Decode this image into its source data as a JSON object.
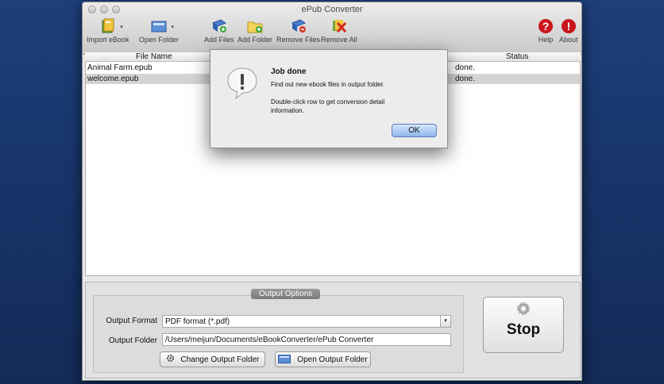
{
  "window": {
    "title": "ePub Converter"
  },
  "toolbar": {
    "import_ebook": "Import eBook",
    "open_folder": "Open Folder",
    "add_files": "Add Files",
    "add_folder": "Add Folder",
    "remove_files": "Remove Files",
    "remove_all": "Remove All",
    "help": "Help",
    "about": "About",
    "dropdown_glyph": "▾"
  },
  "file_list": {
    "columns": [
      "File Name",
      "Status"
    ],
    "rows": [
      {
        "name": "Animal Farm.epub",
        "status": "done."
      },
      {
        "name": "welcome.epub",
        "status": "done."
      }
    ]
  },
  "output_options": {
    "title": "Output Options",
    "format_label": "Output Format",
    "format_value": "PDF format (*.pdf)",
    "folder_label": "Output Folder",
    "folder_value": "/Users/meijun/Documents/eBookConverter/ePub Converter",
    "change_folder": "Change Output Folder",
    "open_folder": "Open Output Folder"
  },
  "stop_button": {
    "label": "Stop"
  },
  "dialog": {
    "title": "Job done",
    "message1": "Find out new ebook files in output folder.",
    "message2": "Double-click row to get conversion detail information.",
    "ok": "OK"
  },
  "colors": {
    "background": "#17356a",
    "help_red": "#c8151b",
    "ok_blue": "#8fb6eb"
  }
}
